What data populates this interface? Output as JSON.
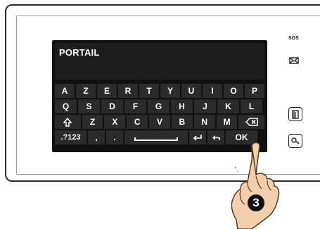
{
  "screen": {
    "text_value": "PORTAIL"
  },
  "keyboard": {
    "row1": [
      "A",
      "Z",
      "E",
      "R",
      "T",
      "Y",
      "U",
      "I",
      "O",
      "P"
    ],
    "row2": [
      "Q",
      "S",
      "D",
      "F",
      "G",
      "H",
      "J",
      "K",
      "L"
    ],
    "row3": [
      "Z",
      "X",
      "C",
      "V",
      "B",
      "N",
      "M"
    ],
    "num_key": ".?123",
    "comma_key": ",",
    "dot_key": ".",
    "ok_key": "OK"
  },
  "side_panel": {
    "sos_label": "SOS"
  },
  "callout": {
    "step_number": "3"
  },
  "colors": {
    "screen_bg": "#111111",
    "key_bg": "#2b2b2b",
    "hand_skin": "#f3cfae",
    "hand_outline": "#5a3a1e"
  },
  "icons": [
    "shift-icon",
    "backspace-icon",
    "enter-icon",
    "back-arrow-icon",
    "mail-icon",
    "door-icon",
    "key-icon",
    "hand-pointer-icon"
  ]
}
